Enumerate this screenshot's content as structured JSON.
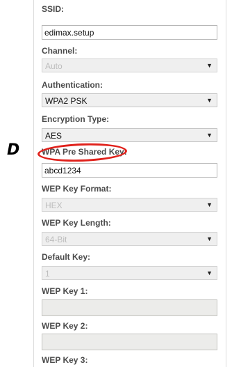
{
  "annotation": {
    "label": "D",
    "highlight_color": "#e0201a"
  },
  "form": {
    "ssid": {
      "label": "SSID:",
      "value": "edimax.setup"
    },
    "channel": {
      "label": "Channel:",
      "value": "Auto",
      "disabled": true
    },
    "authentication": {
      "label": "Authentication:",
      "value": "WPA2 PSK"
    },
    "encryption_type": {
      "label": "Encryption Type:",
      "value": "AES"
    },
    "wpa_psk": {
      "label": "WPA Pre Shared Key:",
      "value": "abcd1234"
    },
    "wep_key_format": {
      "label": "WEP Key Format:",
      "value": "HEX",
      "disabled": true
    },
    "wep_key_length": {
      "label": "WEP Key Length:",
      "value": "64-Bit",
      "disabled": true
    },
    "default_key": {
      "label": "Default Key:",
      "value": "1",
      "disabled": true
    },
    "wep_key_1": {
      "label": "WEP Key 1:",
      "value": "",
      "disabled": true
    },
    "wep_key_2": {
      "label": "WEP Key 2:",
      "value": "",
      "disabled": true
    },
    "wep_key_3": {
      "label": "WEP Key 3:"
    }
  },
  "icons": {
    "dropdown": "chevron-down-icon"
  }
}
